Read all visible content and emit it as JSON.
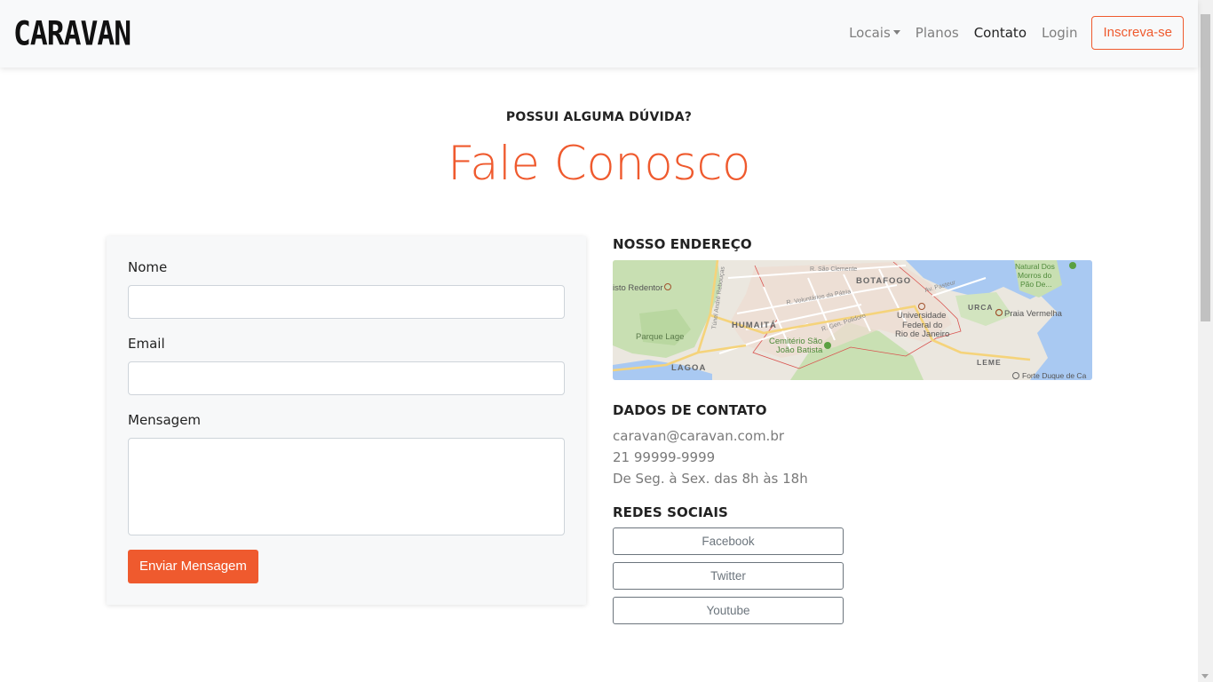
{
  "navbar": {
    "brand": "CARAVAN",
    "links": [
      {
        "label": "Locais",
        "dropdown": true
      },
      {
        "label": "Planos"
      },
      {
        "label": "Contato",
        "active": true
      },
      {
        "label": "Login"
      }
    ],
    "signup_label": "Inscreva-se"
  },
  "header": {
    "eyebrow": "POSSUI ALGUMA DÚVIDA?",
    "title": "Fale Conosco"
  },
  "form": {
    "name_label": "Nome",
    "name_value": "",
    "email_label": "Email",
    "email_value": "",
    "message_label": "Mensagem",
    "message_value": "",
    "submit_label": "Enviar Mensagem"
  },
  "address": {
    "title": "NOSSO ENDEREÇO",
    "map_labels": {
      "botafogo": "BOTAFOGO",
      "humaita": "HUMAITÁ",
      "lagoa": "LAGOA",
      "urca": "URCA",
      "leme": "LEME",
      "cristo": "isto Redentor",
      "parque_lage": "Parque Lage",
      "cemiterio_1": "Cemitério São",
      "cemiterio_2": "João Batista",
      "univ_1": "Universidade",
      "univ_2": "Federal do",
      "univ_3": "Rio de Janeiro",
      "praia": "Praia Vermelha",
      "pao_1": "Natural Dos",
      "pao_2": "Morros do",
      "pao_3": "Pão De...",
      "forte": "Forte Duque de Ca",
      "street_1": "R. São Clemente",
      "street_2": "R. Voluntários da Pátria",
      "street_3": "R. Gen. Polidoro",
      "street_4": "Túnel André Rebouças",
      "street_5": "Av. Pasteur"
    }
  },
  "contact": {
    "title": "DADOS DE CONTATO",
    "email": "caravan@caravan.com.br",
    "phone": "21 99999-9999",
    "hours": "De Seg. à Sex. das 8h às 18h"
  },
  "social": {
    "title": "REDES SOCIAIS",
    "buttons": [
      "Facebook",
      "Twitter",
      "Youtube"
    ]
  },
  "colors": {
    "accent": "#ef5a2e",
    "navbar_bg": "#f8f9fa",
    "muted_text": "#7a7a7a"
  }
}
